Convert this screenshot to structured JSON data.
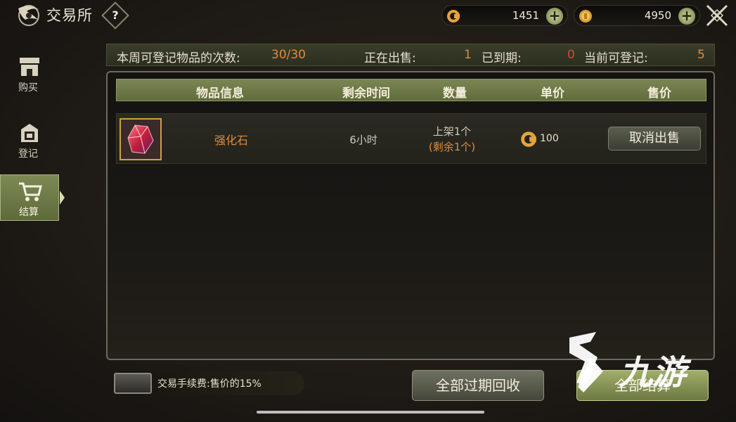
{
  "header": {
    "title": "交易所",
    "help_label": "?",
    "currencies": [
      {
        "icon": "gem-coin-icon",
        "amount": "1451",
        "color": "#e8a33a"
      },
      {
        "icon": "gold-coin-icon",
        "amount": "4950",
        "color": "#d8a035"
      }
    ]
  },
  "sidebar": {
    "items": [
      {
        "label": "购买",
        "icon": "shop-icon",
        "active": false
      },
      {
        "label": "登记",
        "icon": "register-icon",
        "active": false
      },
      {
        "label": "结算",
        "icon": "cart-icon",
        "active": true
      }
    ]
  },
  "stats": {
    "weekly_label": "本周可登记物品的次数:",
    "weekly_value": "30/30",
    "selling_label": "正在出售:",
    "selling_value": "1",
    "expired_label": "已到期:",
    "expired_value": "0",
    "available_label": "当前可登记:",
    "available_value": "5"
  },
  "table": {
    "columns": [
      "物品信息",
      "剩余时间",
      "数量",
      "单价",
      "售价"
    ],
    "rows": [
      {
        "icon": "red-crystal-icon",
        "name": "强化石",
        "time_left": "6小时",
        "qty_listed": "上架1个",
        "qty_remaining": "(剩余1个)",
        "unit_price": "100",
        "action": "取消出售"
      }
    ]
  },
  "footer": {
    "fee_text": "交易手续费:售价的15%",
    "recycle_button": "全部过期回收",
    "settle_button": "全部结算"
  },
  "watermark": {
    "text": "九游"
  },
  "colors": {
    "accent_orange": "#e08a3c",
    "accent_red": "#d8453a",
    "olive": "#6f7a43"
  }
}
